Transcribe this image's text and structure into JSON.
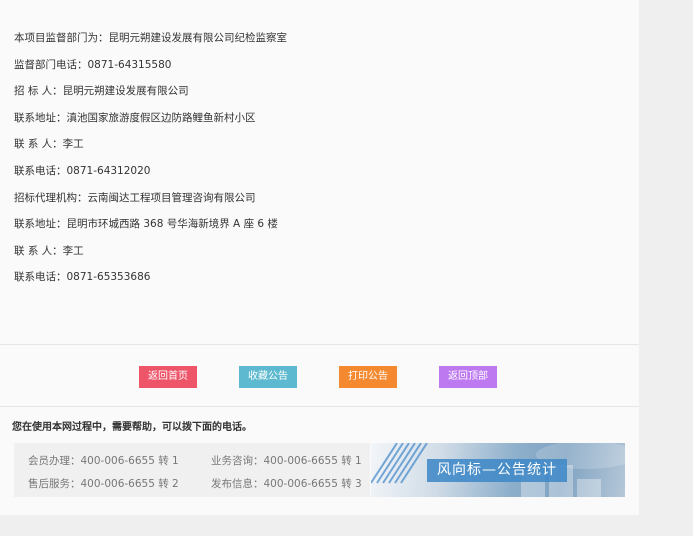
{
  "notice": {
    "lines": [
      "本项目监督部门为：昆明元朔建设发展有限公司纪检监察室",
      "监督部门电话：0871-64315580",
      "招 标 人：昆明元朔建设发展有限公司",
      "联系地址：滇池国家旅游度假区边防路鲤鱼新村小区",
      "联 系 人：李工",
      "联系电话：0871-64312020",
      "招标代理机构：云南闽达工程项目管理咨询有限公司",
      "联系地址：昆明市环城西路 368 号华海新境界 A 座 6 楼",
      "联 系 人：李工",
      "联系电话：0871-65353686"
    ]
  },
  "actions": {
    "home": {
      "label": "返回首页",
      "color": "#ee5569"
    },
    "favorite": {
      "label": "收藏公告",
      "color": "#5db9cf"
    },
    "print": {
      "label": "打印公告",
      "color": "#f5892f"
    },
    "top": {
      "label": "返回顶部",
      "color": "#bd7af0"
    }
  },
  "help": {
    "title": "您在使用本网过程中，需要帮助，可以拨下面的电话。",
    "contacts": {
      "member": "会员办理：400-006-6655 转 1",
      "business": "业务咨询：400-006-6655 转 1",
      "after_sales": "售后服务：400-006-6655 转 2",
      "publish": "发布信息：400-006-6655 转 3"
    }
  },
  "banner": {
    "text": "风向标—公告统计",
    "icon": "chart-stripes-icon"
  }
}
